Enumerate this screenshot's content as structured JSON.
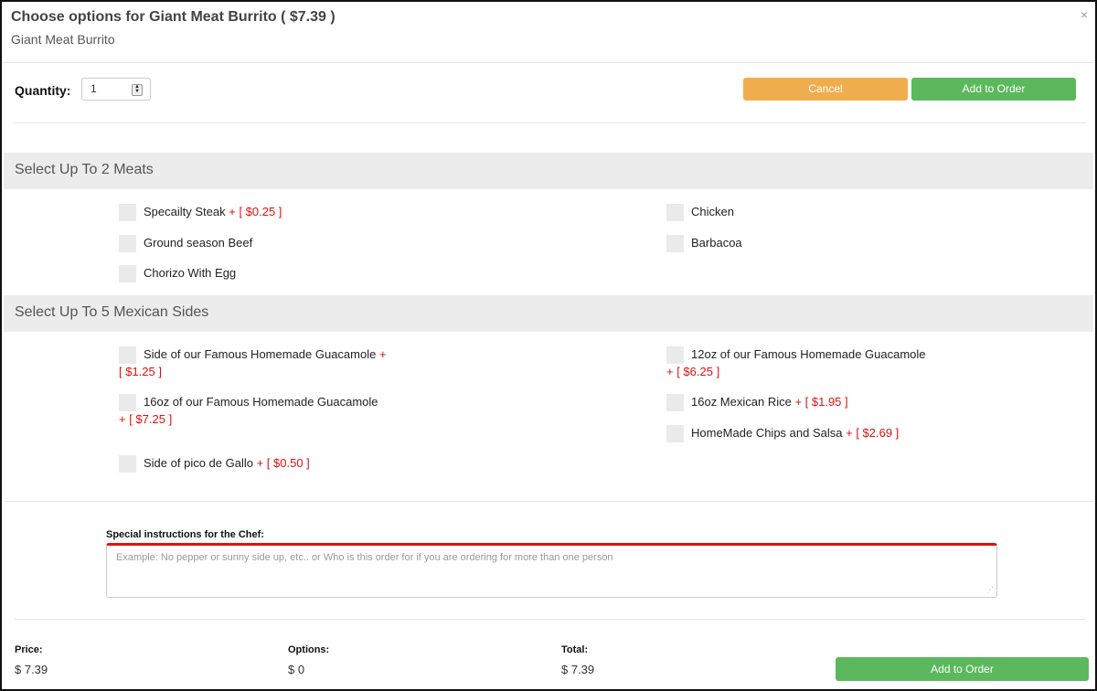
{
  "header": {
    "title": "Choose options for Giant Meat Burrito ( $7.39 )",
    "subtitle": "Giant Meat Burrito",
    "close_glyph": "×"
  },
  "quantity": {
    "label": "Quantity:",
    "value": "1"
  },
  "actions": {
    "cancel_label": "Cancel",
    "add_label": "Add to Order"
  },
  "sections": [
    {
      "title": "Select Up To 2 Meats",
      "options": [
        {
          "label": "Specailty Steak",
          "price": "+ [ $0.25 ]"
        },
        {
          "label": "Chicken",
          "price": ""
        },
        {
          "label": "Ground season Beef",
          "price": ""
        },
        {
          "label": "Barbacoa",
          "price": ""
        },
        {
          "label": "Chorizo With Egg",
          "price": ""
        }
      ]
    },
    {
      "title": "Select Up To 5 Mexican Sides",
      "options": [
        {
          "label": "Side of our Famous Homemade Guacamole",
          "price_a": "+",
          "price_b": "[ $1.25 ]"
        },
        {
          "label": "12oz of our Famous Homemade Guacamole",
          "price": "+ [ $6.25 ]"
        },
        {
          "label": "16oz of our Famous Homemade Guacamole",
          "price": "+ [ $7.25 ]"
        },
        {
          "label": "16oz Mexican Rice",
          "price": "+ [ $1.95 ]"
        },
        {
          "label": "HomeMade Chips and Salsa",
          "price": "+ [ $2.69 ]"
        },
        {
          "label": "Side of pico de Gallo",
          "price": "+ [ $0.50 ]"
        }
      ]
    }
  ],
  "instructions": {
    "label": "Special instructions for the Chef:",
    "placeholder": "Example: No pepper or sunny side up, etc.. or Who is this order for if you are ordering for more than one person"
  },
  "footer": {
    "price_label": "Price:",
    "price_value": "$ 7.39",
    "options_label": "Options:",
    "options_value": "$ 0",
    "total_label": "Total:",
    "total_value": "$ 7.39",
    "add_label": "Add to Order"
  },
  "colors": {
    "cancel": "#f0ad4e",
    "add": "#5cb85c",
    "price_accent": "#e01010"
  }
}
